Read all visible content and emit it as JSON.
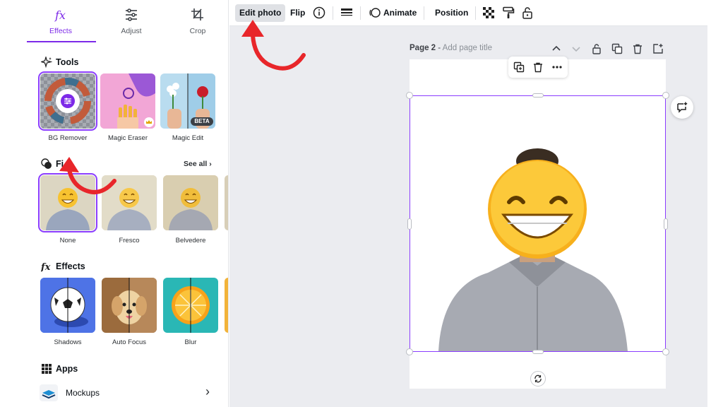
{
  "panel": {
    "tabs": [
      {
        "label": "Effects",
        "icon": "fx-icon"
      },
      {
        "label": "Adjust",
        "icon": "sliders-icon"
      },
      {
        "label": "Crop",
        "icon": "crop-icon"
      }
    ],
    "tools_title": "Tools",
    "tools": [
      {
        "label": "BG Remover",
        "icon": "bg-remover-icon"
      },
      {
        "label": "Magic Eraser",
        "icon": "magic-eraser-icon"
      },
      {
        "label": "Magic Edit",
        "badge": "BETA"
      }
    ],
    "filters_title": "Fi",
    "see_all": "See all",
    "filters": [
      {
        "label": "None"
      },
      {
        "label": "Fresco"
      },
      {
        "label": "Belvedere"
      }
    ],
    "effects_title": "Effects",
    "effects": [
      {
        "label": "Shadows"
      },
      {
        "label": "Auto Focus"
      },
      {
        "label": "Blur"
      }
    ],
    "apps_title": "Apps",
    "apps": [
      {
        "label": "Mockups"
      }
    ]
  },
  "toolbar": {
    "edit_photo": "Edit photo",
    "flip": "Flip",
    "animate": "Animate",
    "position": "Position"
  },
  "page": {
    "label_bold": "Page 2",
    "label_sep": " - ",
    "label_placeholder": "Add page title"
  },
  "colors": {
    "accent": "#8b3dff",
    "annotation": "#e8262a",
    "canvas_bg": "#ebecf0"
  }
}
